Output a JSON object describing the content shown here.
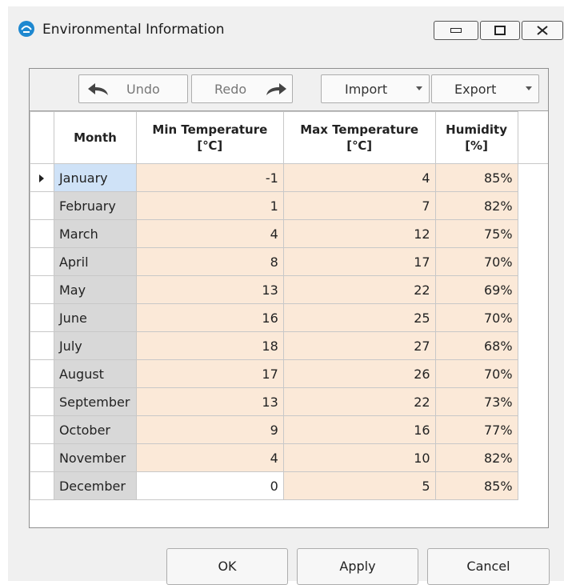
{
  "window": {
    "title": "Environmental Information"
  },
  "toolbar": {
    "undo_label": "Undo",
    "redo_label": "Redo",
    "import_label": "Import",
    "export_label": "Export"
  },
  "table": {
    "headers": {
      "month": "Month",
      "min_line1": "Min Temperature",
      "min_line2": "[℃]",
      "max_line1": "Max Temperature",
      "max_line2": "[℃]",
      "hum_line1": "Humidity",
      "hum_line2": "[%]"
    },
    "rows": [
      {
        "month": "January",
        "min": "-1",
        "max": "4",
        "humidity": "85%"
      },
      {
        "month": "February",
        "min": "1",
        "max": "7",
        "humidity": "82%"
      },
      {
        "month": "March",
        "min": "4",
        "max": "12",
        "humidity": "75%"
      },
      {
        "month": "April",
        "min": "8",
        "max": "17",
        "humidity": "70%"
      },
      {
        "month": "May",
        "min": "13",
        "max": "22",
        "humidity": "69%"
      },
      {
        "month": "June",
        "min": "16",
        "max": "25",
        "humidity": "70%"
      },
      {
        "month": "July",
        "min": "18",
        "max": "27",
        "humidity": "68%"
      },
      {
        "month": "August",
        "min": "17",
        "max": "26",
        "humidity": "70%"
      },
      {
        "month": "September",
        "min": "13",
        "max": "22",
        "humidity": "73%"
      },
      {
        "month": "October",
        "min": "9",
        "max": "16",
        "humidity": "77%"
      },
      {
        "month": "November",
        "min": "4",
        "max": "10",
        "humidity": "82%"
      },
      {
        "month": "December",
        "min": "0",
        "max": "5",
        "humidity": "85%"
      }
    ]
  },
  "footer": {
    "ok_label": "OK",
    "apply_label": "Apply",
    "cancel_label": "Cancel"
  },
  "colors": {
    "cell_value_bg": "#fbe9d8",
    "month_cell_bg": "#d8d8d8",
    "selected_month_bg": "#cfe2f7",
    "app_icon": "#1e88d0"
  },
  "icons": [
    "app-icon",
    "minimize-icon",
    "maximize-icon",
    "close-icon",
    "undo-arrow-icon",
    "redo-arrow-icon",
    "dropdown-arrow-icon",
    "row-pointer-icon"
  ]
}
